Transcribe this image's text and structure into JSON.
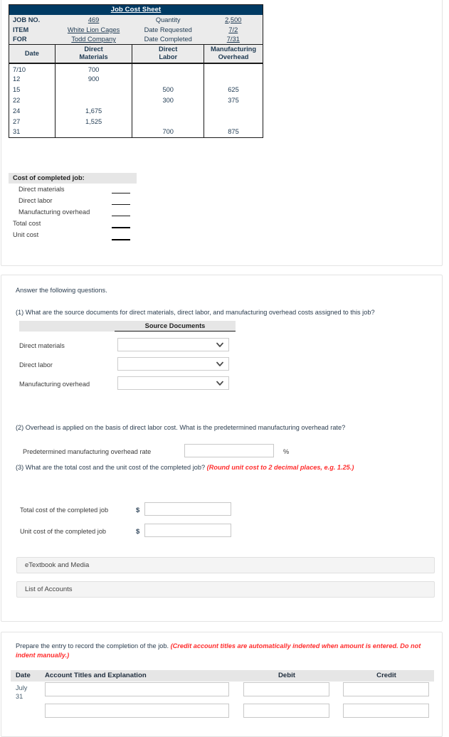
{
  "job_cost_sheet": {
    "title": "Job Cost Sheet",
    "meta_rows": [
      {
        "label": "JOB NO.",
        "value": "469",
        "label2": "Quantity",
        "value2": "2,500"
      },
      {
        "label": "ITEM",
        "value": "White Lion Cages",
        "label2": "Date Requested",
        "value2": "7/2"
      },
      {
        "label": "FOR",
        "value": "Todd Company",
        "label2": "Date Completed",
        "value2": "7/31"
      }
    ],
    "columns": [
      "Date",
      "Direct Materials",
      "Direct Labor",
      "Manufacturing Overhead"
    ],
    "column_lines": [
      {
        "l1": "",
        "l2": "Date"
      },
      {
        "l1": "Direct",
        "l2": "Materials"
      },
      {
        "l1": "Direct",
        "l2": "Labor"
      },
      {
        "l1": "Manufacturing",
        "l2": "Overhead"
      }
    ],
    "rows": [
      {
        "date": "7/10",
        "dm": "700",
        "dl": "",
        "moh": ""
      },
      {
        "date": "12",
        "dm": "900",
        "dl": "",
        "moh": ""
      },
      {
        "date": "15",
        "dm": "",
        "dl": "500",
        "moh": "625"
      },
      {
        "date": "22",
        "dm": "",
        "dl": "300",
        "moh": "375"
      },
      {
        "date": "24",
        "dm": "1,675",
        "dl": "",
        "moh": ""
      },
      {
        "date": "27",
        "dm": "1,525",
        "dl": "",
        "moh": ""
      },
      {
        "date": "31",
        "dm": "",
        "dl": "700",
        "moh": "875"
      }
    ]
  },
  "cost_block": {
    "heading": "Cost of completed job:",
    "lines": [
      {
        "label": "Direct materials",
        "indent": true,
        "rule": "thin"
      },
      {
        "label": "Direct labor",
        "indent": true,
        "rule": "thin"
      },
      {
        "label": "Manufacturing overhead",
        "indent": true,
        "rule": "thin"
      },
      {
        "label": "Total cost",
        "indent": false,
        "rule": "thick"
      },
      {
        "label": "Unit cost",
        "indent": false,
        "rule": "thick"
      }
    ]
  },
  "questions": {
    "intro": "Answer the following questions.",
    "q1": "(1) What are the source documents for direct materials, direct labor, and manufacturing overhead costs assigned to this job?",
    "source_documents_header": "Source Documents",
    "source_rows": [
      {
        "label": "Direct materials",
        "value": "",
        "placeholder": ""
      },
      {
        "label": "Direct labor",
        "value": "",
        "placeholder": ""
      },
      {
        "label": "Manufacturing overhead",
        "value": "",
        "placeholder": ""
      }
    ],
    "q2": "(2) Overhead is applied on the basis of direct labor cost. What is the predetermined manufacturing overhead rate?",
    "q2_label": "Predetermined manufacturing overhead rate",
    "q2_value": "",
    "q2_suffix": "%",
    "q3_plain": "(3) What are the total cost and the unit cost of the completed job? ",
    "q3_hint": "(Round unit cost to 2 decimal places, e.g. 1.25.)",
    "q3_rows": [
      {
        "label": "Total cost of the completed job",
        "currency": "$",
        "value": ""
      },
      {
        "label": "Unit cost of the completed job",
        "currency": "$",
        "value": ""
      }
    ]
  },
  "buttons": {
    "etextbook": "eTextbook and Media",
    "list_of_accounts": "List of Accounts"
  },
  "journal": {
    "instruction_plain": "Prepare the entry to record the completion of the job. ",
    "instruction_hint": "(Credit account titles are automatically indented when amount is entered. Do not indent manually.)",
    "columns": [
      "Date",
      "Account Titles and Explanation",
      "Debit",
      "Credit"
    ],
    "date_lines": [
      "July",
      "31"
    ],
    "rows": [
      {
        "account": "",
        "debit": "",
        "credit": ""
      },
      {
        "account": "",
        "debit": "",
        "credit": ""
      }
    ]
  },
  "colors": {
    "header_navy": "#003a63",
    "band_gray": "#e6e6e6",
    "hint_red": "#ff2d2d",
    "text_slate": "#2c3e50"
  }
}
